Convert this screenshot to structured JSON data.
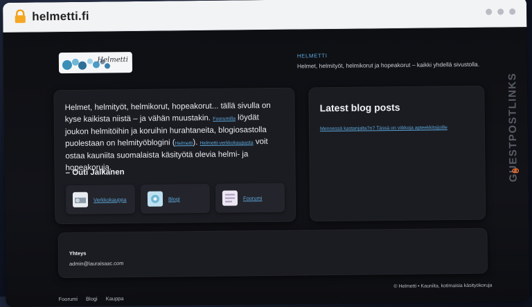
{
  "browser": {
    "url": "helmetti.fi"
  },
  "watermark": {
    "text": "GUESTPOSTLINKS"
  },
  "header": {
    "logo_text": "Helmetti",
    "site_name": "HELMETTI",
    "tagline": "Helmet, helmityöt, helmikorut ja hopeakorut – kaikki yhdellä sivustolla."
  },
  "intro": {
    "text_1": "Helmet, helmityöt, helmikorut, hopeakorut... tällä sivulla on kyse kaikista niistä – ja vähän muustakin.",
    "link_1": "Foorumilla",
    "text_2": "löydät joukon helmitöihin ja koruihin hurahtaneita, blogiosastolla puolestaan on helmityöblogini (",
    "link_2": "Helmetti",
    "text_3": ").",
    "link_3": "Helmetti-verkkokaupasta",
    "text_4": "voit ostaa kauniita suomalaista käsityötä olevia helmi- ja hopeakoruja.",
    "signature": "– Outi Jalkanen"
  },
  "tiles": [
    {
      "label": "Verkkokauppa",
      "icon": "shop-thumbnail-icon"
    },
    {
      "label": "Blogi",
      "icon": "blog-thumbnail-icon"
    },
    {
      "label": "Foorumi",
      "icon": "forum-thumbnail-icon"
    }
  ],
  "blog": {
    "title": "Latest blog posts",
    "post": "Mennessä kastanjalta?n? Tässä on viikkoja apteekkitsijoille"
  },
  "contact": {
    "title": "Yhteys",
    "email": "admin@lauraisaac.com"
  },
  "footer": {
    "links": [
      "Foorumi",
      "Blogi",
      "Kauppa"
    ],
    "copyright": "© Helmetti • Kauniita, kotimaisia käsityökoruja"
  },
  "colors": {
    "accent_link": "#5ba6d9",
    "page_bg": "#0e0f13",
    "card_bg": "#1b1c22",
    "watermark_orange": "#e56a2c"
  }
}
